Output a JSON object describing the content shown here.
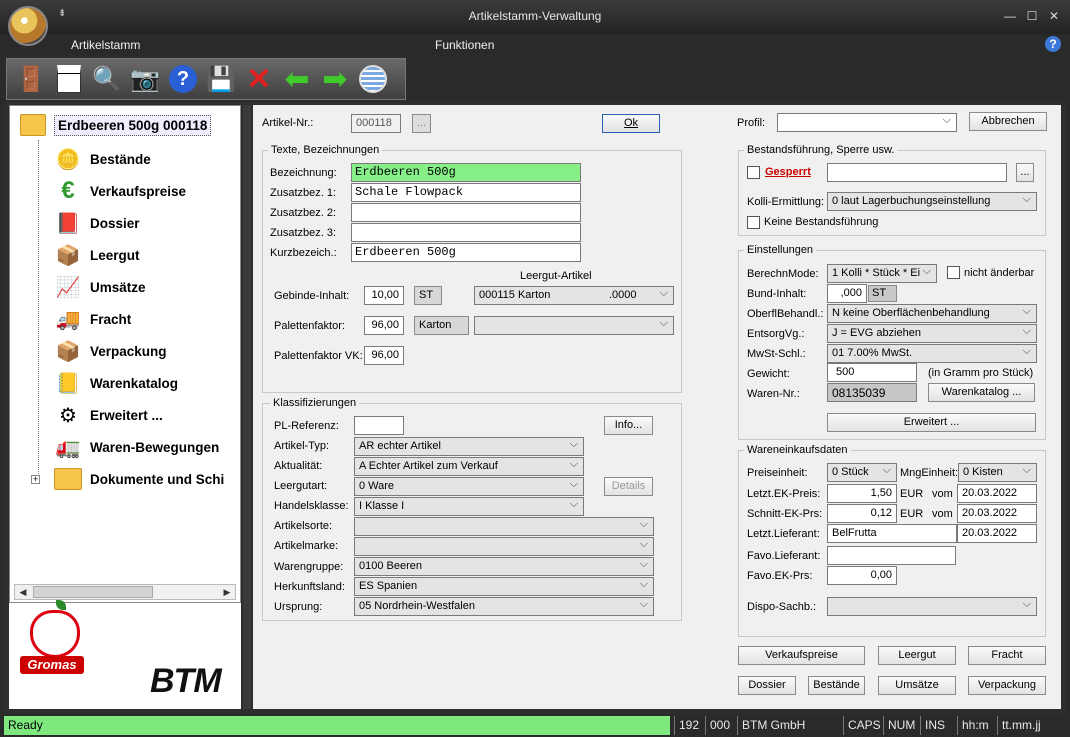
{
  "window": {
    "title": "Artikelstamm-Verwaltung",
    "minimize": "—",
    "maximize": "☐",
    "close": "✕"
  },
  "menu": {
    "artikelstamm": "Artikelstamm",
    "funktionen": "Funktionen",
    "help": "?"
  },
  "tree": {
    "root": "Erdbeeren 500g 000118",
    "items": [
      {
        "label": "Bestände",
        "icon": "coins-icon"
      },
      {
        "label": "Verkaufspreise",
        "icon": "euro-icon"
      },
      {
        "label": "Dossier",
        "icon": "book-icon"
      },
      {
        "label": "Leergut",
        "icon": "boxes-icon"
      },
      {
        "label": "Umsätze",
        "icon": "chart-icon"
      },
      {
        "label": "Fracht",
        "icon": "truck-icon"
      },
      {
        "label": "Verpackung",
        "icon": "package-icon"
      },
      {
        "label": "Warenkatalog",
        "icon": "catalog-icon"
      },
      {
        "label": "Erweitert ...",
        "icon": "gears-icon"
      },
      {
        "label": "Waren-Bewegungen",
        "icon": "truck-moving-icon"
      },
      {
        "label": "Dokumente und Schi",
        "icon": "folder-icon"
      }
    ]
  },
  "logos": {
    "gromas": "Gromas",
    "btm": "BTM"
  },
  "form": {
    "artikel_nr_label": "Artikel-Nr.:",
    "artikel_nr": "000118",
    "dots": "...",
    "ok": "Ok",
    "texte_group": "Texte, Bezeichnungen",
    "bezeichnung_label": "Bezeichnung:",
    "bezeichnung": "Erdbeeren 500g",
    "zusatz1_label": "Zusatzbez. 1:",
    "zusatz1": "Schale Flowpack",
    "zusatz2_label": "Zusatzbez. 2:",
    "zusatz2": "",
    "zusatz3_label": "Zusatzbez. 3:",
    "zusatz3": "",
    "kurz_label": "Kurzbezeich.:",
    "kurz": "Erdbeeren 500g",
    "leergut_artikel_label": "Leergut-Artikel",
    "gebinde_label": "Gebinde-Inhalt:",
    "gebinde": "10,00",
    "gebinde_unit": "ST",
    "leergut_artikel": "000115 Karton",
    "leergut_artikel_val": ".0000",
    "paletten_label": "Palettenfaktor:",
    "paletten": "96,00",
    "paletten_unit": "Karton",
    "paletten_vk_label": "Palettenfaktor VK:",
    "paletten_vk": "96,00",
    "klass_group": "Klassifizierungen",
    "pl_ref_label": "PL-Referenz:",
    "pl_ref": "",
    "info": "Info...",
    "details": "Details",
    "artikeltyp_label": "Artikel-Typ:",
    "artikeltyp": "AR echter Artikel",
    "aktualitaet_label": "Aktualität:",
    "aktualitaet": "A Echter Artikel zum Verkauf",
    "leergutart_label": "Leergutart:",
    "leergutart": "0 Ware",
    "handelsklasse_label": "Handelsklasse:",
    "handelsklasse": "I   Klasse I",
    "artikelsorte_label": "Artikelsorte:",
    "artikelsorte": "",
    "artikelmarke_label": "Artikelmarke:",
    "artikelmarke": "",
    "warengruppe_label": "Warengruppe:",
    "warengruppe": "0100 Beeren",
    "herkunft_label": "Herkunftsland:",
    "herkunft": "ES  Spanien",
    "ursprung_label": "Ursprung:",
    "ursprung": "05 Nordrhein-Westfalen"
  },
  "right": {
    "profil_label": "Profil:",
    "profil": "",
    "abbrechen": "Abbrechen",
    "bestand_group": "Bestandsführung, Sperre usw.",
    "gesperrt": "Gesperrt",
    "gesperrt_text": "",
    "kolli_label": "Kolli-Ermittlung:",
    "kolli": "0 laut Lagerbuchungseinstellung",
    "keine_bestand": "Keine Bestandsführung",
    "einst_group": "Einstellungen",
    "berechn_label": "BerechnMode:",
    "berechn": "1 Kolli * Stück * Ei",
    "nicht_aenderbar": "nicht änderbar",
    "bund_label": "Bund-Inhalt:",
    "bund": ",000",
    "bund_unit": "ST",
    "oberfl_label": "OberflBehandl.:",
    "oberfl": "N keine Oberflächenbehandlung",
    "entsorg_label": "EntsorgVg.:",
    "entsorg": "J = EVG abziehen",
    "mwst_label": "MwSt-Schl.:",
    "mwst": "01  7.00% MwSt.",
    "gewicht_label": "Gewicht:",
    "gewicht": "500",
    "gewicht_hint": "(in Gramm pro Stück)",
    "waren_nr_label": "Waren-Nr.:",
    "waren_nr": "08135039",
    "warenkatalog_btn": "Warenkatalog ...",
    "erweitert_btn": "Erweitert ...",
    "wek_group": "Wareneinkaufsdaten",
    "preiseinheit_label": "Preiseinheit:",
    "preiseinheit": "0 Stück",
    "mng_label": "MngEinheit:",
    "mng": "0 Kisten",
    "letzt_ek_label": "Letzt.EK-Preis:",
    "letzt_ek": "1,50",
    "eur": "EUR",
    "vom": "vom",
    "letzt_ek_date": "20.03.2022",
    "schnitt_label": "Schnitt-EK-Prs:",
    "schnitt": "0,12",
    "schnitt_date": "20.03.2022",
    "letzt_lief_label": "Letzt.Lieferant:",
    "letzt_lief": "BelFrutta",
    "letzt_lief_date": "20.03.2022",
    "favo_lief_label": "Favo.Lieferant:",
    "favo_lief": "",
    "favo_ek_label": "Favo.EK-Prs:",
    "favo_ek": "0,00",
    "dispo_label": "Dispo-Sachb.:",
    "dispo": "",
    "btn_verkaufspreise": "Verkaufspreise",
    "btn_leergut": "Leergut",
    "btn_fracht": "Fracht",
    "btn_dossier": "Dossier",
    "btn_bestaende": "Bestände",
    "btn_umsaetze": "Umsätze",
    "btn_verpackung": "Verpackung"
  },
  "status": {
    "ready": "Ready",
    "f1": "192",
    "f2": "000",
    "f3": "BTM GmbH",
    "caps": "CAPS",
    "num": "NUM",
    "ins": "INS",
    "time": "hh:m",
    "date": "tt.mm.jj"
  }
}
